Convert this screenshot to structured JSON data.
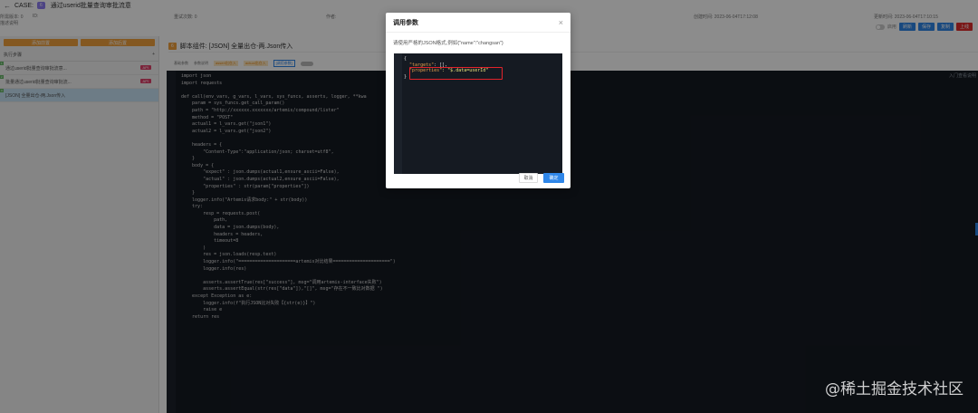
{
  "header": {
    "back_icon": "arrow-left-icon",
    "case_label": "CASE:",
    "case_tag": "6",
    "case_name": "通过userid批量查询审批流意"
  },
  "meta": {
    "version_label": "所需版本: 0",
    "id_label": "ID:",
    "repeat_label": "重试次数: 0",
    "author_label": "作者:",
    "created_label": "创建时间: 2023-06-04T17:12:08",
    "updated_label": "更新时间: 2023-06-04T17:10:15",
    "desc_label": "描述说明"
  },
  "toolbar": {
    "toggle_label": "启用",
    "buttons": [
      "刷新",
      "保存",
      "复制",
      "上线"
    ]
  },
  "left_panel": {
    "btn_left": "添加前置",
    "btn_right": "添加后置",
    "steps_header": "执行步骤",
    "steps_add": "+",
    "steps": [
      {
        "label": "通过userid批量查询审批流意...",
        "badge": "API"
      },
      {
        "label": "批量通过userid批量查询审批流...",
        "badge": "API"
      },
      {
        "label": "[JSON] 全量出仓-两.Json传入",
        "badge": "API"
      }
    ]
  },
  "script": {
    "tag": "6",
    "title": "脚本组件: [JSON] 全量出仓-两.Json传入",
    "tabs": [
      "基础参数",
      "参数说明",
      "assert出仓入",
      "actual出仓入",
      "[调用参数]"
    ],
    "corner_text": "入门查看说明",
    "code_lines": [
      "import json",
      "import requests",
      "",
      "def call(env_vars, g_vars, l_vars, sys_funcs, asserts, logger, **kwa",
      "    param = sys_funcs.get_call_param()",
      "    path = \"http://xxxxxx.xxxxxxx/artemis/compound/lister\"",
      "    method = \"POST\"",
      "    actual1 = l_vars.get(\"json1\")",
      "    actual2 = l_vars.get(\"json2\")",
      "",
      "    headers = {",
      "        \"Content-Type\":\"application/json; charset=utf8\",",
      "    }",
      "    body = {",
      "        \"expect\" : json.dumps(actual1,ensure_ascii=False),",
      "        \"actual\" : json.dumps(actual2,ensure_ascii=False),",
      "        \"properties\" : str(param[\"properties\"])",
      "    }",
      "    logger.info(\"Artemis请求body:\" + str(body))",
      "    try:",
      "        resp = requests.post(",
      "            path,",
      "            data = json.dumps(body),",
      "            headers = headers,",
      "            timeout=8",
      "        )",
      "        res = json.loads(resp.text)",
      "        logger.info(\"=====================artemis对比结果=====================\")",
      "        logger.info(res)",
      "",
      "        asserts.assertTrue(res[\"success\"], msg=\"调用artemis-interface失败\")",
      "        asserts.assertEqual(str(res[\"data\"]),\"[]\", msg=\"存在不一致比对数据 \")",
      "    except Exception as e:",
      "        logger.info(f\"执行JSON比对失败【{str(e)}】\")",
      "        raise e",
      "    return res"
    ]
  },
  "dialog": {
    "title": "调用参数",
    "hint": "请使用严格的JSON格式,例如{\"name\":\"changsan\"}",
    "json_lines": [
      {
        "indent": "{",
        "key": "",
        "val": ""
      },
      {
        "indent": "  ",
        "key": "\"targets\"",
        "val": ": [],"
      },
      {
        "indent": "  ",
        "key": "\"properties\"",
        "val": ": \"$.data=userId\""
      },
      {
        "indent": "}",
        "key": "",
        "val": ""
      }
    ],
    "cancel": "取消",
    "confirm": "确定"
  },
  "watermark": "@稀土掘金技术社区",
  "colors": {
    "accent": "#2f86e8",
    "danger": "#e02c2c",
    "orange": "#f0a13c",
    "editor_bg": "#151a22",
    "highlight_border": "#e2232b"
  }
}
